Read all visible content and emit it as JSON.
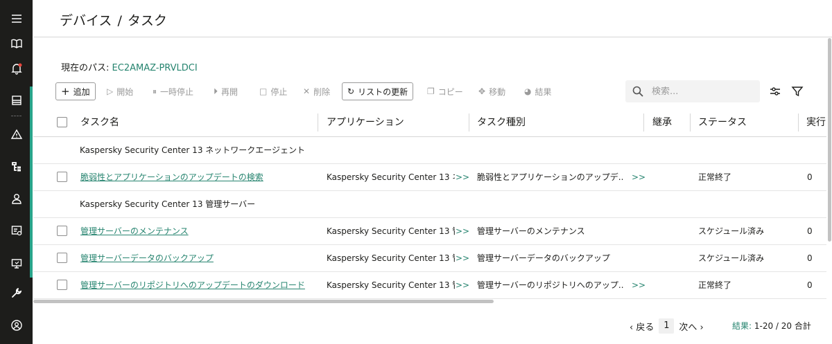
{
  "sidebar": {
    "items": [
      {
        "icon": "menu-icon"
      },
      {
        "icon": "book-icon"
      },
      {
        "icon": "bell-icon"
      },
      {
        "icon": "server-icon"
      },
      {
        "icon": "warning-icon"
      },
      {
        "icon": "devices-tree-icon"
      },
      {
        "icon": "user-icon"
      },
      {
        "icon": "report-icon"
      },
      {
        "icon": "monitor-icon"
      },
      {
        "icon": "wrench-icon"
      },
      {
        "icon": "account-icon"
      }
    ],
    "accent_color": "#29a58c",
    "notification_color": "#e8453c"
  },
  "header": {
    "crumb_1": "デバイス",
    "separator": "/",
    "crumb_2": "タスク"
  },
  "path": {
    "label": "現在のパス:",
    "value": "EC2AMAZ-PRVLDCI"
  },
  "toolbar": {
    "add": "追加",
    "start": "開始",
    "pause": "一時停止",
    "resume": "再開",
    "stop": "停止",
    "delete": "削除",
    "refresh": "リストの更新",
    "copy": "コピー",
    "move": "移動",
    "results": "結果",
    "search_placeholder": "検索..."
  },
  "table": {
    "columns": [
      "タスク名",
      "アプリケーション",
      "タスク種別",
      "継承",
      "ステータス",
      "実行"
    ],
    "groups": [
      {
        "title": "Kaspersky Security Center 13 ネットワークエージェント",
        "rows": [
          {
            "name": "脆弱性とアプリケーションのアップデートの検索",
            "application": "Kaspersky Security Center 13 ネ...",
            "app_more": ">>",
            "type": "脆弱性とアプリケーションのアップデ...",
            "type_more": ">>",
            "status": "正常終了",
            "runs": "0"
          }
        ]
      },
      {
        "title": "Kaspersky Security Center 13 管理サーバー",
        "rows": [
          {
            "name": "管理サーバーのメンテナンス",
            "application": "Kaspersky Security Center 13 管...",
            "app_more": ">>",
            "type": "管理サーバーのメンテナンス",
            "type_more": "",
            "status": "スケジュール済み",
            "runs": "0"
          },
          {
            "name": "管理サーバーデータのバックアップ",
            "application": "Kaspersky Security Center 13 管...",
            "app_more": ">>",
            "type": "管理サーバーデータのバックアップ",
            "type_more": "",
            "status": "スケジュール済み",
            "runs": "0"
          },
          {
            "name": "管理サーバーのリポジトリへのアップデートのダウンロード",
            "application": "Kaspersky Security Center 13 管...",
            "app_more": ">>",
            "type": "管理サーバーのリポジトリへのアップ...",
            "type_more": ">>",
            "status": "正常終了",
            "runs": "0"
          }
        ]
      }
    ]
  },
  "pagination": {
    "prev": "戻る",
    "page": "1",
    "next": "次へ",
    "results_label": "結果:",
    "results_value": "1-20 / 20 合計"
  }
}
